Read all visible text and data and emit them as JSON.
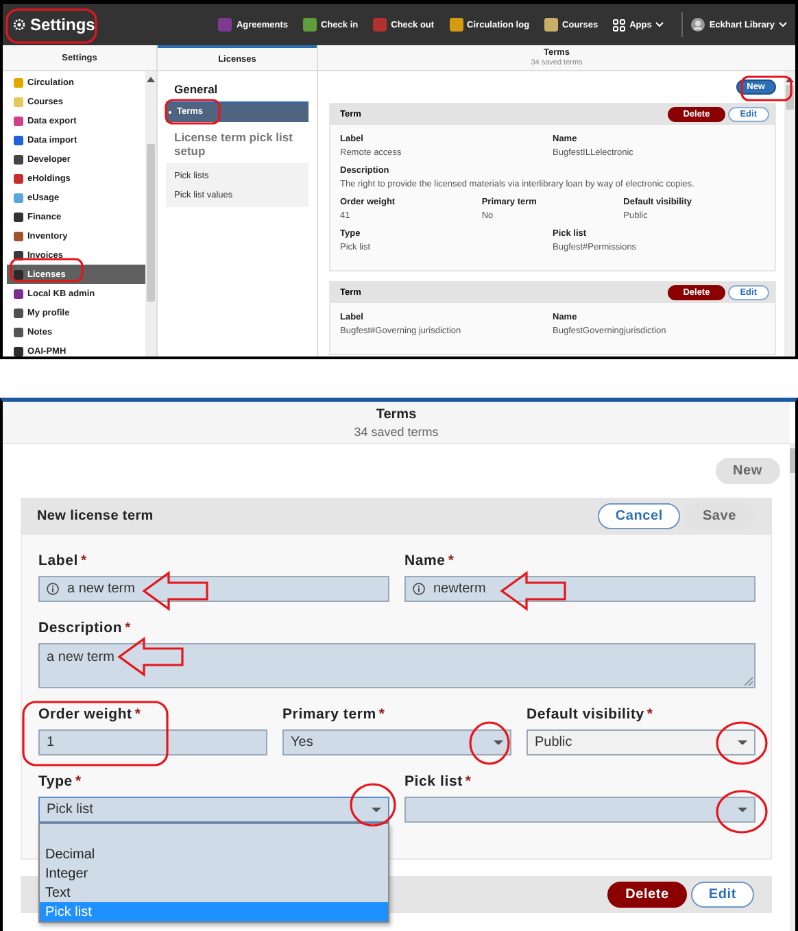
{
  "top_screenshot": {
    "header": {
      "title": "Settings",
      "apps": [
        {
          "label": "Agreements",
          "color": "#7e3a8f"
        },
        {
          "label": "Check in",
          "color": "#5f9e3c"
        },
        {
          "label": "Check out",
          "color": "#b2312f"
        },
        {
          "label": "Circulation log",
          "color": "#d49b12"
        },
        {
          "label": "Courses",
          "color": "#c8b06a"
        }
      ],
      "apps_menu": "Apps",
      "user": "Eckhart Library"
    },
    "settings_pane": {
      "title": "Settings",
      "items": [
        {
          "label": "Circulation",
          "color": "#e0a800",
          "selected": false
        },
        {
          "label": "Courses",
          "color": "#e8c85a",
          "selected": false
        },
        {
          "label": "Data export",
          "color": "#d0408a",
          "selected": false
        },
        {
          "label": "Data import",
          "color": "#1d62d6",
          "selected": false
        },
        {
          "label": "Developer",
          "color": "#444444",
          "selected": false
        },
        {
          "label": "eHoldings",
          "color": "#c62e2e",
          "selected": false
        },
        {
          "label": "eUsage",
          "color": "#58a6dc",
          "selected": false
        },
        {
          "label": "Finance",
          "color": "#333333",
          "selected": false
        },
        {
          "label": "Inventory",
          "color": "#a0522d",
          "selected": false
        },
        {
          "label": "Invoices",
          "color": "#3a3a3a",
          "selected": false
        },
        {
          "label": "Licenses",
          "color": "#2a2a2a",
          "selected": true
        },
        {
          "label": "Local KB admin",
          "color": "#7a2f8f",
          "selected": false
        },
        {
          "label": "My profile",
          "color": "#505050",
          "selected": false
        },
        {
          "label": "Notes",
          "color": "#555555",
          "selected": false
        },
        {
          "label": "OAI-PMH",
          "color": "#2d2d2d",
          "selected": false
        }
      ]
    },
    "licenses_pane": {
      "title": "Licenses",
      "sections": [
        {
          "heading": "General",
          "items": [
            {
              "label": "Terms",
              "selected": true
            }
          ]
        },
        {
          "heading": "License term pick list setup",
          "items": [
            {
              "label": "Pick lists",
              "selected": false
            },
            {
              "label": "Pick list values",
              "selected": false
            }
          ]
        }
      ]
    },
    "terms_pane": {
      "title": "Terms",
      "subtitle": "34 saved terms",
      "new_button": {
        "label": "New",
        "disabled": false
      },
      "cards": [
        {
          "title": "Term",
          "delete": "Delete",
          "edit": "Edit",
          "rows": [
            [
              {
                "label": "Label",
                "value": "Remote access"
              },
              {
                "label": "Name",
                "value": "BugfestILLelectronic"
              }
            ],
            [
              {
                "label": "Description",
                "value": "The right to provide the licensed materials via interlibrary loan by way of electronic copies."
              }
            ],
            [
              {
                "label": "Order weight",
                "value": "41"
              },
              {
                "label": "Primary term",
                "value": "No"
              },
              {
                "label": "Default visibility",
                "value": "Public"
              }
            ],
            [
              {
                "label": "Type",
                "value": "Pick list"
              },
              {
                "label": "Pick list",
                "value": "Bugfest#Permissions"
              }
            ]
          ]
        },
        {
          "title": "Term",
          "delete": "Delete",
          "edit": "Edit",
          "rows": [
            [
              {
                "label": "Label",
                "value": "Bugfest#Governing jurisdiction"
              },
              {
                "label": "Name",
                "value": "BugfestGoverningjurisdiction"
              }
            ]
          ]
        }
      ]
    }
  },
  "bottom_screenshot": {
    "terms_pane": {
      "title": "Terms",
      "subtitle": "34 saved terms",
      "new_button": {
        "label": "New",
        "disabled": true
      },
      "form": {
        "title": "New license term",
        "cancel": "Cancel",
        "save": {
          "label": "Save",
          "disabled": true
        },
        "rows": [
          [
            {
              "kind": "text",
              "label": "Label",
              "required_mark": "*",
              "value": "a new term",
              "info": true,
              "changed": true
            },
            {
              "kind": "text",
              "label": "Name",
              "required_mark": "*",
              "value": "newterm",
              "info": true,
              "changed": true
            }
          ],
          [
            {
              "kind": "textarea",
              "label": "Description",
              "required_mark": "*",
              "value": "a new term",
              "changed": true
            }
          ],
          [
            {
              "kind": "text",
              "label": "Order weight",
              "required_mark": "*",
              "value": "1",
              "info": false,
              "changed": true
            },
            {
              "kind": "select",
              "label": "Primary term",
              "required_mark": "*",
              "value": "Yes",
              "changed": true,
              "open": false
            },
            {
              "kind": "select",
              "label": "Default visibility",
              "required_mark": "*",
              "value": "Public",
              "changed": false,
              "open": false
            }
          ],
          [
            {
              "kind": "select",
              "label": "Type",
              "required_mark": "*",
              "value": "Pick list",
              "changed": true,
              "open": true,
              "options": [
                {
                  "label": "Decimal",
                  "selected": false
                },
                {
                  "label": "Integer",
                  "selected": false
                },
                {
                  "label": "Text",
                  "selected": false
                },
                {
                  "label": "Pick list",
                  "selected": true
                }
              ]
            },
            {
              "kind": "select",
              "label": "Pick list",
              "required_mark": "*",
              "changed": true,
              "open": false
            }
          ]
        ]
      },
      "next_card": {
        "delete": "Delete",
        "edit": "Edit"
      }
    }
  }
}
